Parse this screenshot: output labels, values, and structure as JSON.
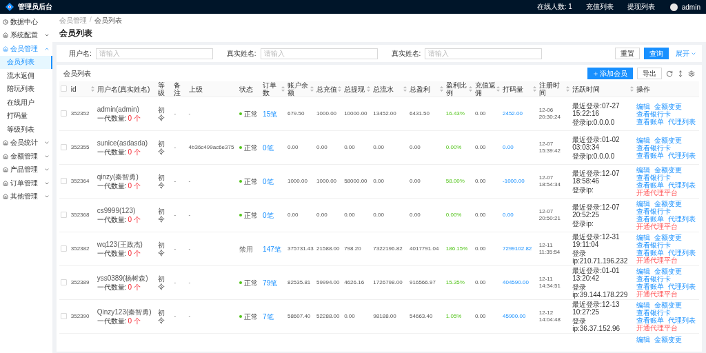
{
  "topbar": {
    "title": "管理员后台",
    "online": "在线人数: 1",
    "links": [
      "充值列表",
      "提现列表"
    ],
    "user": "admin"
  },
  "sidebar": {
    "items": [
      {
        "label": "数据中心",
        "kind": "link",
        "selected": false
      },
      {
        "label": "系统配置",
        "kind": "group",
        "selected": false,
        "expanded": false
      },
      {
        "label": "会员管理",
        "kind": "group",
        "selected": true,
        "expanded": true,
        "children": [
          {
            "label": "会员列表",
            "selected": true
          },
          {
            "label": "流水返佣",
            "selected": false
          },
          {
            "label": "陪玩列表",
            "selected": false
          },
          {
            "label": "在线用户",
            "selected": false
          },
          {
            "label": "打码量",
            "selected": false
          },
          {
            "label": "等级列表",
            "selected": false
          }
        ]
      },
      {
        "label": "会员统计",
        "kind": "group",
        "selected": false,
        "expanded": false
      },
      {
        "label": "金额管理",
        "kind": "group",
        "selected": false,
        "expanded": false
      },
      {
        "label": "产品管理",
        "kind": "group",
        "selected": false,
        "expanded": false
      },
      {
        "label": "订单管理",
        "kind": "group",
        "selected": false,
        "expanded": false
      },
      {
        "label": "其他管理",
        "kind": "group",
        "selected": false,
        "expanded": false
      }
    ]
  },
  "breadcrumb": [
    "会员管理",
    "会员列表"
  ],
  "breadcrumb_separator": "/",
  "page_title": "会员列表",
  "filters": [
    {
      "label": "用户名:",
      "placeholder": "请输入"
    },
    {
      "label": "真实姓名:",
      "placeholder": "请输入"
    },
    {
      "label": "真实姓名:",
      "placeholder": "请输入"
    }
  ],
  "filter_buttons": {
    "reset": "重置",
    "query": "查询",
    "expand": "展开"
  },
  "table": {
    "title": "会员列表",
    "add_button": "添加会员",
    "export_button": "导出",
    "all_checked": false,
    "columns": [
      {
        "label": "id",
        "sortable": true
      },
      {
        "label": "用户名(真实姓名)",
        "sortable": false
      },
      {
        "label": "等级",
        "sortable": false
      },
      {
        "label": "备注",
        "sortable": false
      },
      {
        "label": "上级",
        "sortable": false
      },
      {
        "label": "状态",
        "sortable": false
      },
      {
        "label": "订单数",
        "sortable": true
      },
      {
        "label": "账户余额",
        "sortable": true
      },
      {
        "label": "总充值",
        "sortable": true
      },
      {
        "label": "总提现",
        "sortable": true
      },
      {
        "label": "总流水",
        "sortable": true
      },
      {
        "label": "总盈利",
        "sortable": true
      },
      {
        "label": "盈利比例",
        "sortable": true
      },
      {
        "label": "充值返佣",
        "sortable": true
      },
      {
        "label": "打码量",
        "sortable": true
      },
      {
        "label": "注册时间",
        "sortable": true
      },
      {
        "label": "活跃时间",
        "sortable": true
      },
      {
        "label": "操作",
        "sortable": false
      }
    ],
    "rows": [
      {
        "checked": false,
        "id": "352352",
        "user": "admin(admin)",
        "children_label": "一代数量:",
        "children_count": "0 个",
        "level": "初令",
        "remark": "-",
        "parent": "-",
        "status": {
          "text": "正常",
          "active": true
        },
        "orders": "15笔",
        "balance": "679.50",
        "recharge": "1000.00",
        "withdraw": "10000.00",
        "flow": "13452.00",
        "profit": "6431.50",
        "ratio": "16.43%",
        "rebate": "0.00",
        "code_volume": "2452.00",
        "registered": "12-06 20:30:24",
        "last_login": "最近登录:07-27 15:22:16",
        "login_ip": "登录ip:0.0.0.0",
        "actions": [
          {
            "label": "编辑",
            "kind": "link"
          },
          {
            "label": "金额变更",
            "kind": "link"
          },
          {
            "label": "查看银行卡",
            "kind": "link"
          },
          {
            "label": "查看账单",
            "kind": "link"
          },
          {
            "label": "代理列表",
            "kind": "link"
          }
        ]
      },
      {
        "checked": false,
        "id": "352355",
        "user": "sunice(asdasda)",
        "children_label": "一代数量:",
        "children_count": "0 个",
        "level": "初令",
        "remark": "-",
        "parent": "4b36c499ac6e375",
        "status": {
          "text": "正常",
          "active": true
        },
        "orders": "0笔",
        "balance": "0.00",
        "recharge": "0.00",
        "withdraw": "0.00",
        "flow": "0.00",
        "profit": "0.00",
        "ratio": "0.00%",
        "rebate": "0.00",
        "code_volume": "0.00",
        "registered": "12-07 15:39:42",
        "last_login": "最近登录:01-02 03:03:34",
        "login_ip": "登录ip:0.0.0.0",
        "actions": [
          {
            "label": "编辑",
            "kind": "link"
          },
          {
            "label": "金额变更",
            "kind": "link"
          },
          {
            "label": "查看银行卡",
            "kind": "link"
          },
          {
            "label": "查看账单",
            "kind": "link"
          },
          {
            "label": "代理列表",
            "kind": "link"
          }
        ]
      },
      {
        "checked": false,
        "id": "352364",
        "user": "qinzy(秦智勇)",
        "children_label": "一代数量:",
        "children_count": "0 个",
        "level": "初令",
        "remark": "-",
        "parent": "-",
        "status": {
          "text": "正常",
          "active": true
        },
        "orders": "0笔",
        "balance": "1000.00",
        "recharge": "1000.00",
        "withdraw": "58000.00",
        "flow": "0.00",
        "profit": "0.00",
        "ratio": "58.00%",
        "rebate": "0.00",
        "code_volume": "-1000.00",
        "registered": "12-07 18:54:34",
        "last_login": "最近登录:12-07 18:58:46",
        "login_ip": "登录ip:",
        "actions": [
          {
            "label": "编辑",
            "kind": "link"
          },
          {
            "label": "金额变更",
            "kind": "link"
          },
          {
            "label": "查看银行卡",
            "kind": "link"
          },
          {
            "label": "查看账单",
            "kind": "link"
          },
          {
            "label": "代理列表",
            "kind": "link"
          },
          {
            "label": "开通代理平台",
            "kind": "danger"
          }
        ]
      },
      {
        "checked": false,
        "id": "352368",
        "user": "cs9999(123)",
        "children_label": "一代数量:",
        "children_count": "0 个",
        "level": "初令",
        "remark": "-",
        "parent": "-",
        "status": {
          "text": "正常",
          "active": true
        },
        "orders": "0笔",
        "balance": "0.00",
        "recharge": "0.00",
        "withdraw": "0.00",
        "flow": "0.00",
        "profit": "0.00",
        "ratio": "0.00%",
        "rebate": "0.00",
        "code_volume": "0.00",
        "registered": "12-07 20:50:21",
        "last_login": "最近登录:12-07 20:52:25",
        "login_ip": "登录ip:",
        "actions": [
          {
            "label": "编辑",
            "kind": "link"
          },
          {
            "label": "金额变更",
            "kind": "link"
          },
          {
            "label": "查看银行卡",
            "kind": "link"
          },
          {
            "label": "查看账单",
            "kind": "link"
          },
          {
            "label": "代理列表",
            "kind": "link"
          },
          {
            "label": "开通代理平台",
            "kind": "danger"
          }
        ]
      },
      {
        "checked": false,
        "id": "352382",
        "user": "wq123(王政杰)",
        "children_label": "一代数量:",
        "children_count": "0 个",
        "level": "初令",
        "remark": "-",
        "parent": "-",
        "status": {
          "text": "禁用",
          "active": false
        },
        "orders": "147笔",
        "balance": "375731.43",
        "recharge": "21588.00",
        "withdraw": "798.20",
        "flow": "7322196.82",
        "profit": "4017791.04",
        "ratio": "186.15%",
        "rebate": "0.00",
        "code_volume": "7299102.82",
        "registered": "12-11 11:35:54",
        "last_login": "最近登录:12-31 19:11:04",
        "login_ip": "登录ip:210.71.196.232",
        "actions": [
          {
            "label": "编辑",
            "kind": "link"
          },
          {
            "label": "金额变更",
            "kind": "link"
          },
          {
            "label": "查看银行卡",
            "kind": "link"
          },
          {
            "label": "查看账单",
            "kind": "link"
          },
          {
            "label": "代理列表",
            "kind": "link"
          },
          {
            "label": "开通代理平台",
            "kind": "danger"
          }
        ]
      },
      {
        "checked": false,
        "id": "352389",
        "user": "yss0389(杨树森)",
        "children_label": "一代数量:",
        "children_count": "0 个",
        "level": "初令",
        "remark": "-",
        "parent": "-",
        "status": {
          "text": "正常",
          "active": true
        },
        "orders": "79笔",
        "balance": "82535.81",
        "recharge": "59994.00",
        "withdraw": "4626.16",
        "flow": "1726798.00",
        "profit": "916566.97",
        "ratio": "15.35%",
        "rebate": "0.00",
        "code_volume": "404590.00",
        "registered": "12-11 14:34:51",
        "last_login": "最近登录:01-01 13:20:42",
        "login_ip": "登录ip:39.144.178.229",
        "actions": [
          {
            "label": "编辑",
            "kind": "link"
          },
          {
            "label": "金额变更",
            "kind": "link"
          },
          {
            "label": "查看银行卡",
            "kind": "link"
          },
          {
            "label": "查看账单",
            "kind": "link"
          },
          {
            "label": "代理列表",
            "kind": "link"
          },
          {
            "label": "开通代理平台",
            "kind": "danger"
          }
        ]
      },
      {
        "checked": false,
        "id": "352390",
        "user": "Qinzy123(秦智勇)",
        "children_label": "一代数量:",
        "children_count": "0 个",
        "level": "初令",
        "remark": "-",
        "parent": "-",
        "status": {
          "text": "正常",
          "active": true
        },
        "orders": "7笔",
        "balance": "58607.40",
        "recharge": "52288.00",
        "withdraw": "0.00",
        "flow": "98188.00",
        "profit": "54663.40",
        "ratio": "1.05%",
        "rebate": "0.00",
        "code_volume": "45900.00",
        "registered": "12-12 14:04:48",
        "last_login": "最近登录:12-13 10:27:25",
        "login_ip": "登录ip:36.37.152.96",
        "actions": [
          {
            "label": "编辑",
            "kind": "link"
          },
          {
            "label": "金额变更",
            "kind": "link"
          },
          {
            "label": "查看银行卡",
            "kind": "link"
          },
          {
            "label": "查看账单",
            "kind": "link"
          },
          {
            "label": "代理列表",
            "kind": "link"
          },
          {
            "label": "开通代理平台",
            "kind": "danger"
          }
        ]
      }
    ],
    "partial_row": {
      "actions": [
        {
          "label": "编辑",
          "kind": "link"
        },
        {
          "label": "金额变更",
          "kind": "link"
        }
      ]
    }
  }
}
